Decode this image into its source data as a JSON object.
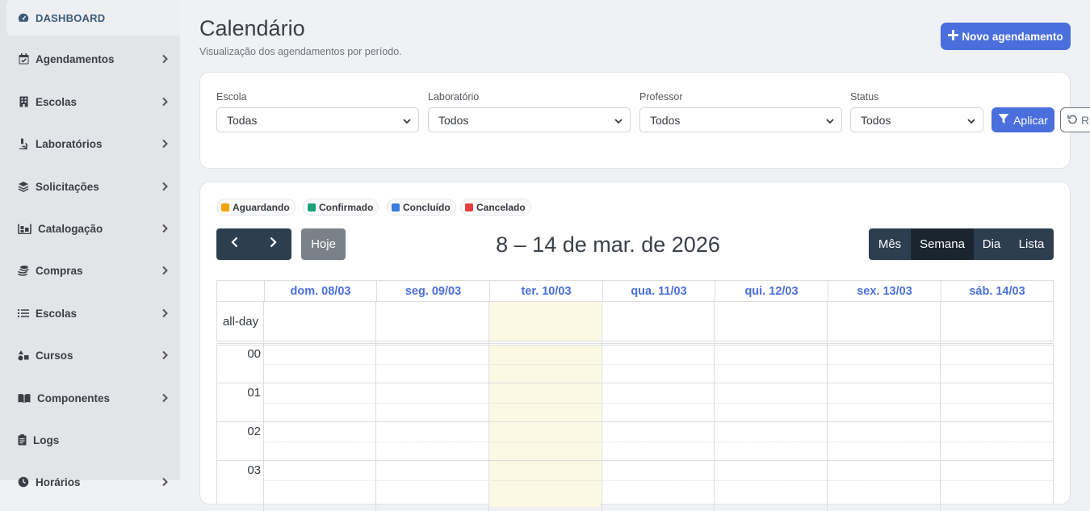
{
  "sidebar": {
    "items": [
      {
        "label": "DASHBOARD",
        "icon": "gauge-icon",
        "active": true
      },
      {
        "label": "Agendamentos",
        "icon": "calendar-check-icon"
      },
      {
        "label": "Escolas",
        "icon": "building-icon"
      },
      {
        "label": "Laboratórios",
        "icon": "microscope-icon"
      },
      {
        "label": "Solicitações",
        "icon": "layers-icon"
      },
      {
        "label": "Catalogação",
        "icon": "warehouse-icon"
      },
      {
        "label": "Compras",
        "icon": "coins-icon"
      },
      {
        "label": "Escolas",
        "icon": "list-icon"
      },
      {
        "label": "Cursos",
        "icon": "shapes-icon"
      },
      {
        "label": "Componentes",
        "icon": "book-icon"
      },
      {
        "label": "Logs",
        "icon": "clipboard-icon"
      },
      {
        "label": "Horários",
        "icon": "clock-icon"
      }
    ]
  },
  "header": {
    "title": "Calendário",
    "subtitle": "Visualização dos agendamentos por período.",
    "new_button": "Novo agendamento"
  },
  "filters": {
    "escola": {
      "label": "Escola",
      "value": "Todas"
    },
    "laboratorio": {
      "label": "Laboratório",
      "value": "Todos"
    },
    "professor": {
      "label": "Professor",
      "value": "Todos"
    },
    "status": {
      "label": "Status",
      "value": "Todos"
    },
    "apply_label": "Aplicar",
    "reset_label": "Re"
  },
  "legend": [
    {
      "label": "Aguardando",
      "color": "#f0a30a"
    },
    {
      "label": "Confirmado",
      "color": "#1aa37a"
    },
    {
      "label": "Concluído",
      "color": "#3b7ddd"
    },
    {
      "label": "Cancelado",
      "color": "#e53e3e"
    }
  ],
  "calendar": {
    "today_label": "Hoje",
    "title": "8 – 14 de mar. de 2026",
    "views": [
      "Mês",
      "Semana",
      "Dia",
      "Lista"
    ],
    "active_view": "Semana",
    "days": [
      "dom. 08/03",
      "seg. 09/03",
      "ter. 10/03",
      "qua. 11/03",
      "qui. 12/03",
      "sex. 13/03",
      "sáb. 14/03"
    ],
    "today_index": 2,
    "allday_label": "all-day",
    "hours": [
      "00",
      "01",
      "02",
      "03"
    ]
  },
  "colors": {
    "accent": "#4a6fdc",
    "dark": "#2c3e50",
    "today_bg": "#fcf8e3"
  }
}
